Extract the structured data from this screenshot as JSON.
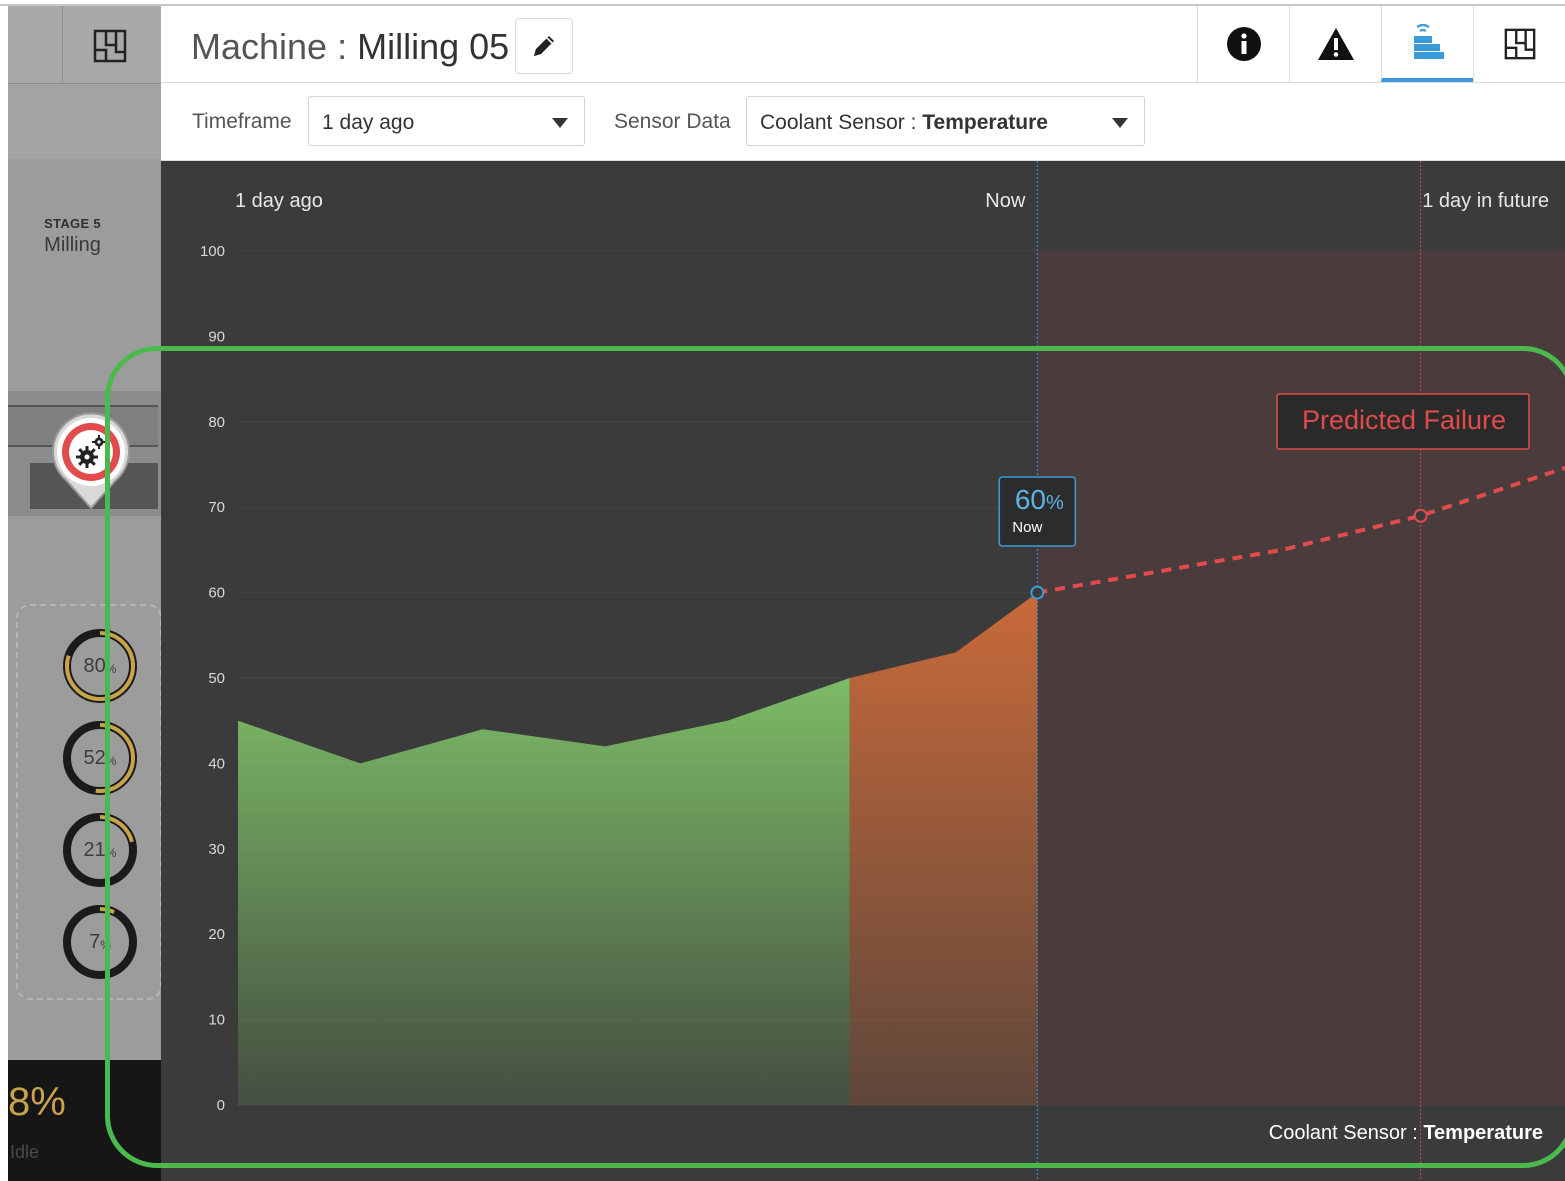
{
  "header": {
    "title_prefix": "Machine",
    "title_separator": " : ",
    "machine_name": "Milling 05",
    "tabs": [
      {
        "name": "info",
        "icon": "info-icon"
      },
      {
        "name": "alerts",
        "icon": "warning-icon"
      },
      {
        "name": "sensors",
        "icon": "sensor-stack-icon",
        "active": true
      },
      {
        "name": "layout",
        "icon": "layout-icon"
      }
    ]
  },
  "filters": {
    "timeframe_label": "Timeframe",
    "timeframe_value": "1 day ago",
    "sensor_label": "Sensor Data",
    "sensor_name": "Coolant Sensor",
    "sensor_separator": " : ",
    "sensor_metric": "Temperature"
  },
  "sidebar": {
    "stage_label": "STAGE 5",
    "stage_name": "Milling",
    "gauges": [
      {
        "value": "80",
        "unit": "%",
        "fraction": 0.8
      },
      {
        "value": "52",
        "unit": "%",
        "fraction": 0.52
      },
      {
        "value": "21",
        "unit": "%",
        "fraction": 0.21
      },
      {
        "value": "7",
        "unit": "%",
        "fraction": 0.07
      }
    ],
    "idle_value": "8%",
    "idle_label": "Idle"
  },
  "colors": {
    "accent": "#3a9bd8",
    "normal": "#7cbb66",
    "warning": "#c96a3a",
    "failure": "#e24b4b",
    "highlight": "#4cb94f",
    "gauge": "#c9a34a"
  },
  "chart_data": {
    "type": "area",
    "x_labels": [
      "1 day ago",
      "Now",
      "1 day in future"
    ],
    "yticks": [
      0,
      10,
      20,
      30,
      40,
      50,
      60,
      70,
      80,
      90,
      100
    ],
    "ylim": [
      0,
      100
    ],
    "x_range": [
      0,
      16
    ],
    "now_x": 12,
    "future_x": 16,
    "series": [
      {
        "segment": "normal",
        "points": [
          [
            0,
            45
          ],
          [
            1.5,
            40
          ],
          [
            3,
            44
          ],
          [
            4.5,
            42
          ],
          [
            6,
            45
          ],
          [
            7.5,
            50
          ]
        ]
      },
      {
        "segment": "warning",
        "points": [
          [
            7.5,
            50
          ],
          [
            8.8,
            53
          ],
          [
            9.8,
            60
          ]
        ]
      },
      {
        "segment": "predicted",
        "points": [
          [
            9.8,
            60
          ],
          [
            12.8,
            65
          ],
          [
            14.5,
            69
          ],
          [
            16.4,
            75
          ]
        ]
      }
    ],
    "now_value": "60",
    "now_unit": "%",
    "now_label": "Now",
    "failure_label": "Predicted Failure",
    "sensor_name": "Coolant Sensor",
    "sensor_separator": " : ",
    "sensor_metric": "Temperature"
  }
}
